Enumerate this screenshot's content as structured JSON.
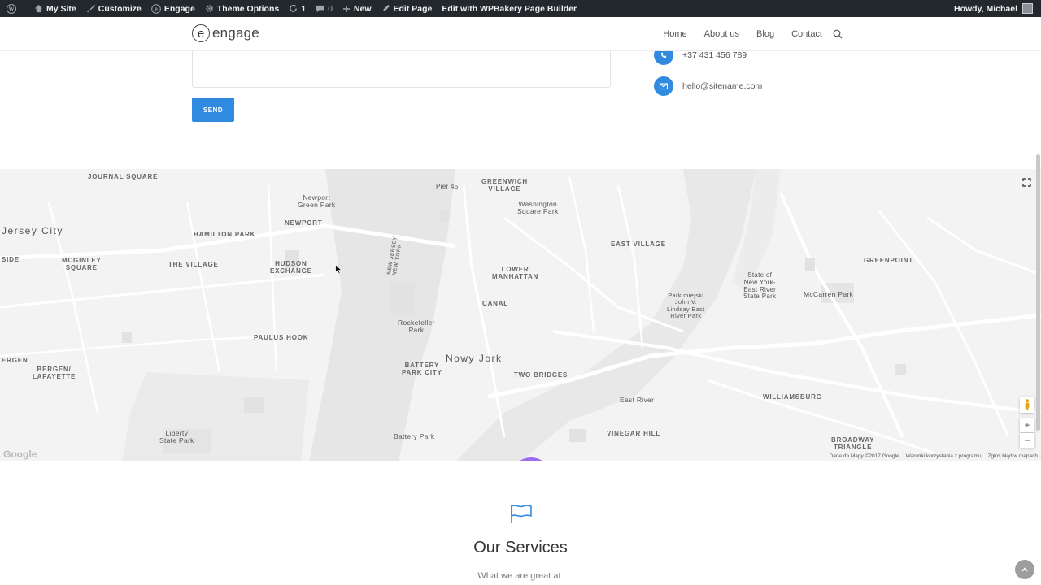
{
  "adminbar": {
    "my_site": "My Site",
    "customize": "Customize",
    "engage": "Engage",
    "theme_options": "Theme Options",
    "updates_count": "1",
    "comments_count": "0",
    "new": "New",
    "edit_page": "Edit Page",
    "edit_with": "Edit with WPBakery Page Builder",
    "howdy": "Howdy, Michael"
  },
  "header": {
    "logo_mark": "e",
    "logo_text": "engage",
    "nav": [
      "Home",
      "About us",
      "Blog",
      "Contact"
    ]
  },
  "form": {
    "send_label": "SEND"
  },
  "contact": {
    "phone": "+37 431 456 789",
    "email": "hello@sitename.com"
  },
  "map": {
    "labels": {
      "journal_square": "JOURNAL SQUARE",
      "jersey_city": "Jersey City",
      "newport_green": "Newport\nGreen Park",
      "newport": "NEWPORT",
      "hamilton_park": "HAMILTON PARK",
      "side": "SIDE",
      "mcginley": "MCGINLEY\nSQUARE",
      "the_village": "THE VILLAGE",
      "hudson_exchange": "HUDSON\nEXCHANGE",
      "paulus_hook": "PAULUS HOOK",
      "bergen": "ERGEN",
      "bergen_lafayette": "BERGEN/\nLAFAYETTE",
      "liberty_state_park": "Liberty\nState Park",
      "greenwich_village": "GREENWICH\nVILLAGE",
      "pier_45": "Pier 45",
      "washington_sq": "Washington\nSquare Park",
      "east_village": "EAST VILLAGE",
      "lower_manhattan": "LOWER\nMANHATTAN",
      "canal": "CANAL",
      "rockefeller": "Rockefeller\nPark",
      "battery_park_city": "BATTERY\nPARK CITY",
      "nowy_jork": "Nowy Jork",
      "two_bridges": "TWO BRIDGES",
      "battery_park": "Battery Park",
      "vinegar_hill": "VINEGAR HILL",
      "east_river": "East River",
      "park_miejski": "Park miejski\nJohn V.\nLindsay East\nRiver Park",
      "state_park": "State of\nNew York-\nEast River\nState Park",
      "mccarren": "McCarren Park",
      "greenpoint": "GREENPOINT",
      "williamsburg": "WILLIAMSBURG",
      "broadway_triangle": "BROADWAY\nTRIANGLE",
      "new_jersey": "NEW JERSEY\nNEW YORK"
    },
    "footer": {
      "data": "Dane do Mapy ©2017 Google",
      "terms": "Warunki korzystania z programu",
      "report": "Zgłoś błąd w mapach"
    },
    "google": "Google",
    "zoom_in": "+",
    "zoom_out": "−"
  },
  "services": {
    "title": "Our Services",
    "subtitle": "What we are great at."
  },
  "colors": {
    "accent": "#2f8ae0",
    "pin": "#9b6cf2",
    "adminbar": "#23282d"
  }
}
